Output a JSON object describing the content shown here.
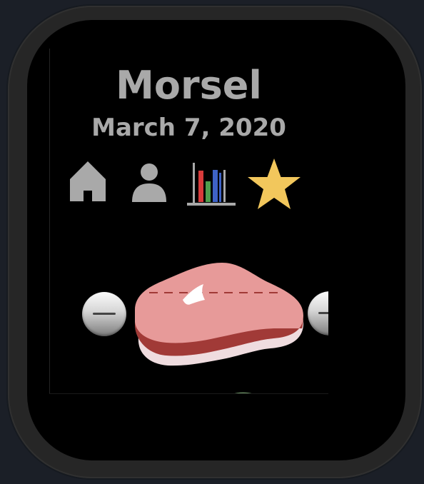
{
  "app": {
    "title": "Morsel",
    "date": "March 7, 2020"
  },
  "nav": {
    "items": [
      {
        "id": "home",
        "icon": "home-icon",
        "active": false
      },
      {
        "id": "profile",
        "icon": "person-icon",
        "active": false
      },
      {
        "id": "stats",
        "icon": "bar-chart-icon",
        "active": false
      },
      {
        "id": "favorites",
        "icon": "star-icon",
        "active": true
      }
    ]
  },
  "colors": {
    "screen_background": "#000000",
    "text_gray": "#a9a9a9",
    "icon_gray": "#a9a9a9",
    "star_gold": "#f2c75c",
    "bar_red": "#d93b3b",
    "bar_green": "#4f9e4d",
    "bar_blue": "#3e63c6",
    "steak_pink": "#e79a99",
    "steak_dark": "#a13a37",
    "steak_fat": "#efdcdf",
    "food_green": "#6a8f63"
  },
  "portion": {
    "current_item": "steak-icon",
    "next_item": "vegetable-icon",
    "decrease_icon": "minus-icon",
    "increase_icon": "plus-icon"
  }
}
